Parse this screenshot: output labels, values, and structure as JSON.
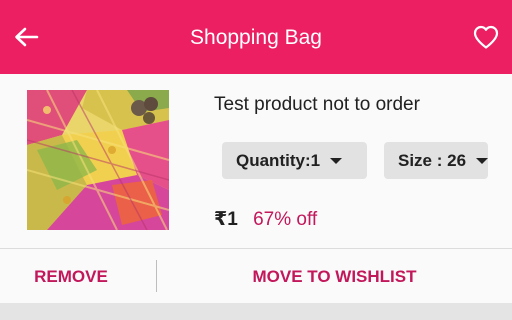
{
  "header": {
    "title": "Shopping Bag",
    "back_icon": "arrow-left-icon",
    "wishlist_icon": "heart-outline-icon",
    "color": "#ec1f63"
  },
  "cart_item": {
    "name": "Test product not to order",
    "image_alt": "product-image",
    "quantity_label": "Quantity:1",
    "size_label": "Size : 26",
    "price": "₹1",
    "discount": "67% off"
  },
  "actions": {
    "remove_label": "REMOVE",
    "move_label": "MOVE TO WISHLIST",
    "color": "#c2185b"
  }
}
